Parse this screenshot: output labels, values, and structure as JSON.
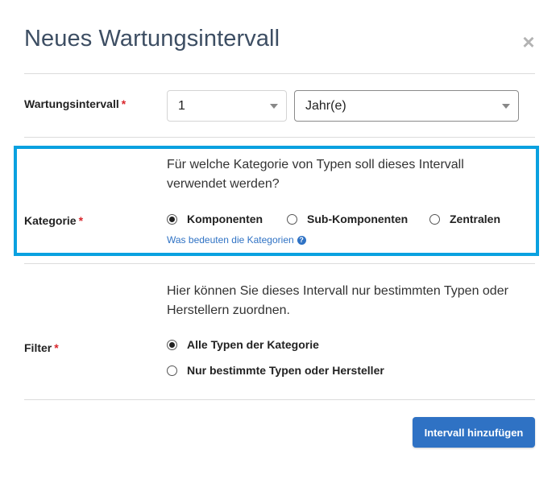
{
  "dialog": {
    "title": "Neues Wartungsintervall",
    "close_symbol": "×"
  },
  "interval": {
    "label": "Wartungsintervall",
    "required_mark": "*",
    "count_value": "1",
    "unit_value": "Jahr(e)"
  },
  "category": {
    "label": "Kategorie",
    "required_mark": "*",
    "question": "Für welche Kategorie von Typen soll dieses Intervall verwendet werden?",
    "options": [
      {
        "label": "Komponenten",
        "selected": true
      },
      {
        "label": "Sub-Komponenten",
        "selected": false
      },
      {
        "label": "Zentralen",
        "selected": false
      }
    ],
    "help_link": "Was bedeuten die Kategorien",
    "help_icon": "?"
  },
  "filter": {
    "label": "Filter",
    "required_mark": "*",
    "description": "Hier können Sie dieses Intervall nur bestimmten Typen oder Herstellern zuordnen.",
    "options": [
      {
        "label": "Alle Typen der Kategorie",
        "selected": true
      },
      {
        "label": "Nur bestimmte Typen oder Hersteller",
        "selected": false
      }
    ]
  },
  "actions": {
    "submit_label": "Intervall hinzufügen"
  },
  "colors": {
    "accent": "#2f72c4",
    "highlight_border": "#0aa1e0",
    "required": "#d9262c",
    "title": "#3d4e63"
  }
}
